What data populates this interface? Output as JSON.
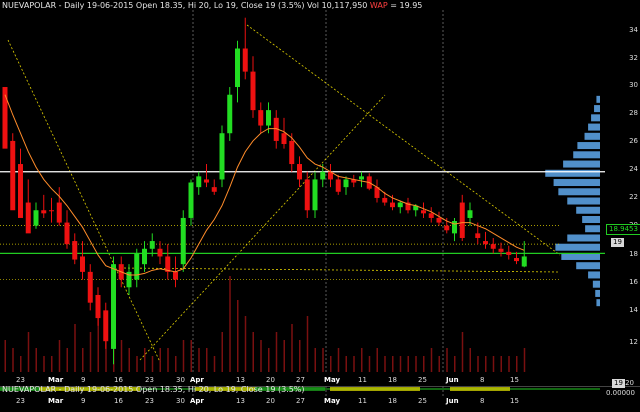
{
  "main": {
    "header": {
      "symbol": "NUEVAPOLAR",
      "text": "- Daily 19-06-2015 Open 18.35, Hi 20, Lo 19, Close 19 (3.5%) Vol 10,117,950",
      "wap_label": "WAP",
      "wap_value": "= 19.95"
    },
    "y_ticks": [
      "34",
      "32",
      "30",
      "28",
      "26",
      "24",
      "22",
      "20",
      "18",
      "16",
      "14",
      "12"
    ],
    "price_tag": "18.9453",
    "close_tag": "19",
    "x_ticks": [
      "23",
      "Mar",
      "9",
      "16",
      "23",
      "30",
      "Apr",
      "13",
      "20",
      "27",
      "May",
      "11",
      "18",
      "25",
      "Jun",
      "8",
      "15"
    ]
  },
  "sub": {
    "header": {
      "symbol": "NUEVAPOLAR",
      "text": "- Daily 19-06-2015 Open 18.35, Hi 20, Lo 19, Close 19 (3.5%)"
    },
    "y_tick": "20",
    "close_tag": "19",
    "zero_tag": "0.00000",
    "x_ticks": [
      "23",
      "Mar",
      "9",
      "16",
      "23",
      "30",
      "Apr",
      "13",
      "20",
      "27",
      "May",
      "11",
      "18",
      "25",
      "Jun",
      "8",
      "15"
    ]
  },
  "colors": {
    "up": "#22dd22",
    "down": "#ee1111",
    "ma": "#ff8c2a",
    "profile": "#5aa0e0",
    "hline_white": "#ffffff",
    "hline_green": "#22cc22",
    "trend": "#e0d000"
  },
  "chart_data": {
    "type": "candlestick",
    "title": "NUEVAPOLAR - Daily 19-06-2015",
    "ylim": [
      11.5,
      35
    ],
    "candles": [
      [
        30,
        28.5,
        28,
        26,
        "dn"
      ],
      [
        26.5,
        27,
        25,
        22,
        "dn"
      ],
      [
        25,
        26,
        22.5,
        21.5,
        "dn"
      ],
      [
        22.5,
        24,
        21,
        20.5,
        "dn"
      ],
      [
        21,
        22.5,
        20.8,
        22,
        "up"
      ],
      [
        22,
        23,
        21.5,
        21.8,
        "dn"
      ],
      [
        22,
        22.8,
        21.2,
        22,
        "dn"
      ],
      [
        22.5,
        23.5,
        21,
        21.2,
        "dn"
      ],
      [
        21.2,
        22,
        19.5,
        19.8,
        "dn"
      ],
      [
        20,
        20.5,
        18.5,
        18.8,
        "dn"
      ],
      [
        19,
        20,
        17.5,
        18,
        "dn"
      ],
      [
        18,
        18.5,
        15.5,
        16,
        "dn"
      ],
      [
        16.5,
        17,
        14.5,
        15,
        "dn"
      ],
      [
        15.5,
        16,
        13,
        13.5,
        "dn"
      ],
      [
        13,
        19,
        12,
        18.5,
        "up"
      ],
      [
        18.5,
        19,
        17,
        17.5,
        "dn"
      ],
      [
        17,
        18.5,
        16.5,
        18,
        "up"
      ],
      [
        17.5,
        19.5,
        17,
        19.2,
        "up"
      ],
      [
        18.5,
        20,
        18,
        19.5,
        "up"
      ],
      [
        19.5,
        20.5,
        19,
        20,
        "up"
      ],
      [
        19.5,
        20,
        18.5,
        19,
        "dn"
      ],
      [
        19,
        19.8,
        17.5,
        18,
        "dn"
      ],
      [
        18,
        19,
        17,
        17.5,
        "dn"
      ],
      [
        18.5,
        22,
        18,
        21.5,
        "up"
      ],
      [
        21.5,
        24,
        21,
        23.8,
        "up"
      ],
      [
        23.5,
        24.5,
        23,
        24.2,
        "up"
      ],
      [
        24,
        25,
        23.5,
        23.8,
        "dn"
      ],
      [
        23.5,
        24,
        23,
        23.2,
        "dn"
      ],
      [
        24,
        27.5,
        23.5,
        27,
        "up"
      ],
      [
        27,
        30,
        26.5,
        29.5,
        "up"
      ],
      [
        30,
        33,
        29,
        32.5,
        "up"
      ],
      [
        32.5,
        34.5,
        30.5,
        31,
        "dn"
      ],
      [
        31,
        32,
        28,
        28.5,
        "dn"
      ],
      [
        28.5,
        29,
        27,
        27.5,
        "dn"
      ],
      [
        27.5,
        29,
        27,
        28.5,
        "up"
      ],
      [
        28,
        28.5,
        26,
        26.5,
        "dn"
      ],
      [
        27,
        28,
        26,
        26.3,
        "dn"
      ],
      [
        26.5,
        27,
        24.5,
        25,
        "dn"
      ],
      [
        25,
        25.5,
        23.5,
        24,
        "dn"
      ],
      [
        24,
        24.5,
        21.5,
        22,
        "dn"
      ],
      [
        22,
        24.5,
        21.5,
        24,
        "up"
      ],
      [
        24,
        25,
        23.5,
        24.5,
        "up"
      ],
      [
        24.5,
        25,
        23.5,
        24,
        "dn"
      ],
      [
        24,
        24.3,
        23,
        23.2,
        "dn"
      ],
      [
        23.5,
        24.2,
        23,
        24,
        "up"
      ],
      [
        24,
        24.3,
        23.5,
        23.8,
        "dn"
      ],
      [
        24,
        24.5,
        23.5,
        24.2,
        "up"
      ],
      [
        24.2,
        24.4,
        23.3,
        23.4,
        "dn"
      ],
      [
        23.5,
        24,
        22.5,
        22.8,
        "dn"
      ],
      [
        22.8,
        23.2,
        22.3,
        22.5,
        "dn"
      ],
      [
        22.5,
        23,
        22,
        22.2,
        "dn"
      ],
      [
        22.2,
        22.6,
        21.8,
        22.5,
        "up"
      ],
      [
        22.5,
        22.8,
        21.8,
        22,
        "dn"
      ],
      [
        22,
        22.4,
        21.6,
        22.3,
        "up"
      ],
      [
        22,
        22.5,
        21.5,
        21.8,
        "dn"
      ],
      [
        21.8,
        22.2,
        21.2,
        21.5,
        "dn"
      ],
      [
        21.5,
        21.9,
        21,
        21.2,
        "dn"
      ],
      [
        21,
        21.5,
        20.5,
        20.7,
        "dn"
      ],
      [
        20.5,
        21.5,
        20,
        21.3,
        "up"
      ],
      [
        22.5,
        23,
        20,
        20.2,
        "dn"
      ],
      [
        21.5,
        22.5,
        21,
        22,
        "up"
      ],
      [
        20.5,
        21.2,
        19.8,
        20.2,
        "dn"
      ],
      [
        20,
        20.6,
        19.5,
        19.8,
        "dn"
      ],
      [
        19.8,
        20.2,
        19.2,
        19.5,
        "dn"
      ],
      [
        19.5,
        19.9,
        19,
        19.3,
        "dn"
      ],
      [
        19.3,
        19.7,
        18.8,
        19.1,
        "dn"
      ],
      [
        18.9,
        19.3,
        18.5,
        18.7,
        "dn"
      ],
      [
        18.35,
        20,
        18.3,
        19,
        "up"
      ]
    ],
    "moving_average": [
      29.5,
      28.2,
      27,
      25.8,
      24.8,
      24,
      23.4,
      22.9,
      22.3,
      21.6,
      20.9,
      20,
      19.1,
      18.4,
      18.2,
      18,
      17.8,
      17.8,
      17.9,
      18.1,
      18.2,
      18.1,
      18,
      18.2,
      18.9,
      19.8,
      20.7,
      21.4,
      22.3,
      23.5,
      24.8,
      25.8,
      26.5,
      27,
      27.3,
      27.3,
      27.1,
      26.7,
      26.1,
      25.4,
      25,
      24.8,
      24.5,
      24.2,
      24.1,
      24,
      23.9,
      23.8,
      23.5,
      23.1,
      22.8,
      22.6,
      22.4,
      22.3,
      22.1,
      21.9,
      21.6,
      21.3,
      21.1,
      21.2,
      21.2,
      21,
      20.8,
      20.5,
      20.2,
      19.9,
      19.6,
      19.4
    ],
    "horizontal_levels": {
      "white": 24.5,
      "green": 19.2,
      "dotted": [
        21,
        19.8,
        17.5
      ]
    },
    "volume_profile_at_levels": [
      [
        22,
        40
      ],
      [
        22.6,
        55
      ],
      [
        23.2,
        70
      ],
      [
        23.8,
        78
      ],
      [
        24.4,
        92
      ],
      [
        25,
        62
      ],
      [
        25.6,
        45
      ],
      [
        26.2,
        38
      ],
      [
        26.8,
        26
      ],
      [
        27.4,
        20
      ],
      [
        28,
        15
      ],
      [
        21.4,
        30
      ],
      [
        20.8,
        25
      ],
      [
        20.2,
        55
      ],
      [
        19.6,
        75
      ],
      [
        19,
        65
      ],
      [
        18.4,
        40
      ],
      [
        17.8,
        20
      ],
      [
        17.2,
        12
      ],
      [
        16.6,
        8
      ],
      [
        16,
        6
      ],
      [
        28.6,
        10
      ],
      [
        29.2,
        6
      ]
    ]
  }
}
